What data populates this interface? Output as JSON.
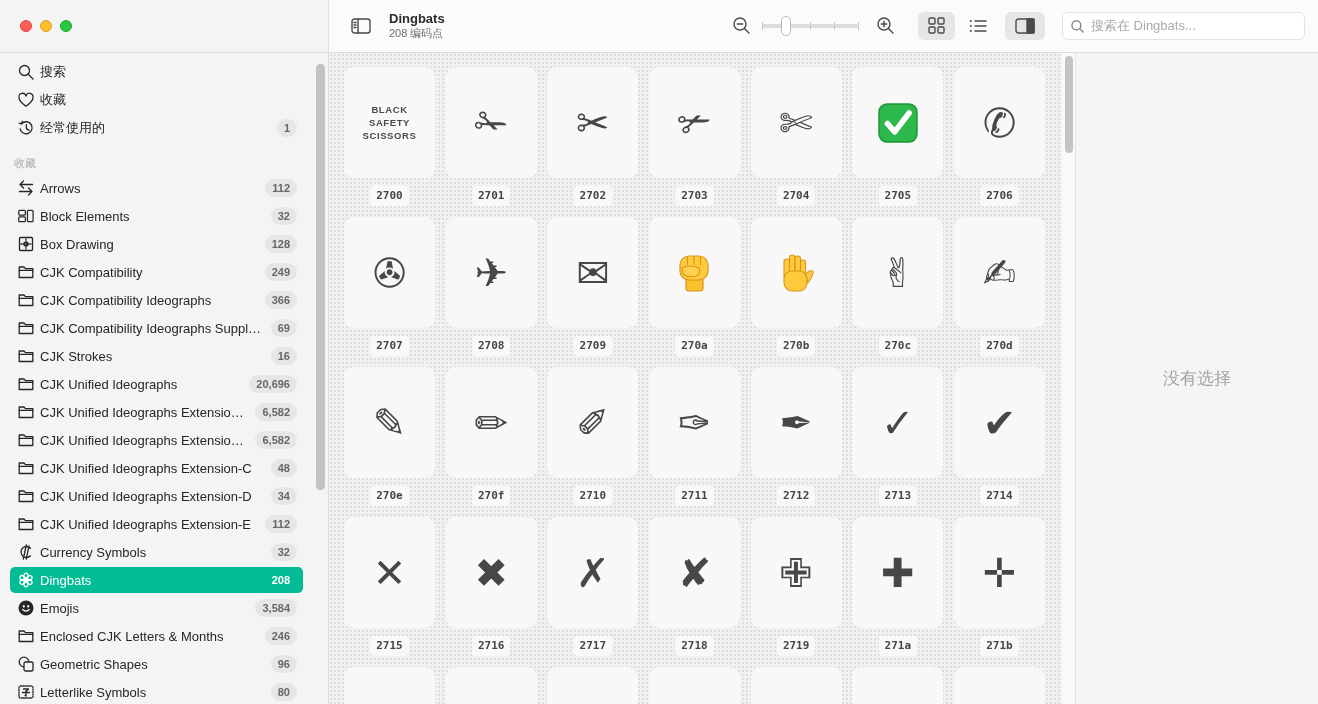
{
  "sidebar": {
    "items": [
      {
        "kind": "search",
        "label": "搜索",
        "selected": false
      },
      {
        "kind": "heart",
        "label": "收藏",
        "selected": false
      },
      {
        "kind": "history",
        "label": "经常使用的",
        "count": "1",
        "selected": false
      }
    ],
    "sections": [
      {
        "title": "收藏",
        "items": [
          {
            "kind": "arrows",
            "label": "Arrows",
            "count": "112",
            "selected": false
          },
          {
            "kind": "blocks",
            "label": "Block Elements",
            "count": "32",
            "selected": false
          },
          {
            "kind": "box",
            "label": "Box Drawing",
            "count": "128",
            "selected": false
          },
          {
            "kind": "folder",
            "label": "CJK Compatibility",
            "count": "249",
            "selected": false
          },
          {
            "kind": "folder",
            "label": "CJK Compatibility Ideographs",
            "count": "366",
            "selected": false
          },
          {
            "kind": "folder",
            "label": "CJK Compatibility Ideographs Suppl…",
            "count": "69",
            "selected": false
          },
          {
            "kind": "folder",
            "label": "CJK Strokes",
            "count": "16",
            "selected": false
          },
          {
            "kind": "folder",
            "label": "CJK Unified Ideographs",
            "count": "20,696",
            "selected": false
          },
          {
            "kind": "folder",
            "label": "CJK Unified Ideographs Extensio…",
            "count": "6,582",
            "selected": false
          },
          {
            "kind": "folder",
            "label": "CJK Unified Ideographs Extensio…",
            "count": "6,582",
            "selected": false
          },
          {
            "kind": "folder",
            "label": "CJK Unified Ideographs Extension-C",
            "count": "48",
            "selected": false
          },
          {
            "kind": "folder",
            "label": "CJK Unified Ideographs Extension-D",
            "count": "34",
            "selected": false
          },
          {
            "kind": "folder",
            "label": "CJK Unified Ideographs Extension-E",
            "count": "112",
            "selected": false
          },
          {
            "kind": "currency",
            "label": "Currency Symbols",
            "count": "32",
            "selected": false
          },
          {
            "kind": "dingbat",
            "label": "Dingbats",
            "count": "208",
            "selected": true
          },
          {
            "kind": "emoji",
            "label": "Emojis",
            "count": "3,584",
            "selected": false
          },
          {
            "kind": "folder",
            "label": "Enclosed CJK Letters & Months",
            "count": "246",
            "selected": false
          },
          {
            "kind": "shapes",
            "label": "Geometric Shapes",
            "count": "96",
            "selected": false
          },
          {
            "kind": "letterlike",
            "label": "Letterlike Symbols",
            "count": "80",
            "selected": false
          }
        ]
      }
    ]
  },
  "toolbar": {
    "title": "Dingbats",
    "subtitle": "208 编码点",
    "zoom": {
      "level": 0.25
    },
    "views": [
      {
        "kind": "grid",
        "selected": true
      },
      {
        "kind": "list",
        "selected": false
      }
    ],
    "inspector": {
      "on": true
    },
    "search": {
      "placeholder": "搜索在 Dingbats..."
    }
  },
  "glyphs": [
    {
      "kind": "name",
      "name": "BLACK SAFETY SCISSORS",
      "code": "2700"
    },
    {
      "kind": "char",
      "char": "✁",
      "code": "2701"
    },
    {
      "kind": "char",
      "char": "✂",
      "code": "2702"
    },
    {
      "kind": "char",
      "char": "✃",
      "code": "2703"
    },
    {
      "kind": "char",
      "char": "✄",
      "code": "2704"
    },
    {
      "kind": "check",
      "code": "2705"
    },
    {
      "kind": "char",
      "char": "✆",
      "code": "2706"
    },
    {
      "kind": "char",
      "char": "✇",
      "code": "2707"
    },
    {
      "kind": "char",
      "char": "✈",
      "code": "2708"
    },
    {
      "kind": "char",
      "char": "✉",
      "code": "2709"
    },
    {
      "kind": "fist",
      "code": "270a"
    },
    {
      "kind": "hand",
      "code": "270b"
    },
    {
      "kind": "char",
      "char": "✌",
      "code": "270c"
    },
    {
      "kind": "char",
      "char": "✍",
      "code": "270d"
    },
    {
      "kind": "char",
      "char": "✎",
      "code": "270e"
    },
    {
      "kind": "char",
      "char": "✏",
      "code": "270f"
    },
    {
      "kind": "char",
      "char": "✐",
      "code": "2710"
    },
    {
      "kind": "char",
      "char": "✑",
      "code": "2711"
    },
    {
      "kind": "char",
      "char": "✒",
      "code": "2712"
    },
    {
      "kind": "char",
      "char": "✓",
      "code": "2713"
    },
    {
      "kind": "char",
      "char": "✔",
      "code": "2714"
    },
    {
      "kind": "char",
      "char": "✕",
      "code": "2715"
    },
    {
      "kind": "char",
      "char": "✖",
      "code": "2716"
    },
    {
      "kind": "char",
      "char": "✗",
      "code": "2717"
    },
    {
      "kind": "char",
      "char": "✘",
      "code": "2718"
    },
    {
      "kind": "char",
      "char": "✙",
      "code": "2719"
    },
    {
      "kind": "char",
      "char": "✚",
      "code": "271a"
    },
    {
      "kind": "char",
      "char": "✛",
      "code": "271b"
    },
    {
      "kind": "cut"
    },
    {
      "kind": "cut"
    },
    {
      "kind": "cut"
    },
    {
      "kind": "cut"
    },
    {
      "kind": "cut"
    },
    {
      "kind": "cut"
    },
    {
      "kind": "cut"
    }
  ],
  "detail": {
    "empty_message": "没有选择"
  }
}
